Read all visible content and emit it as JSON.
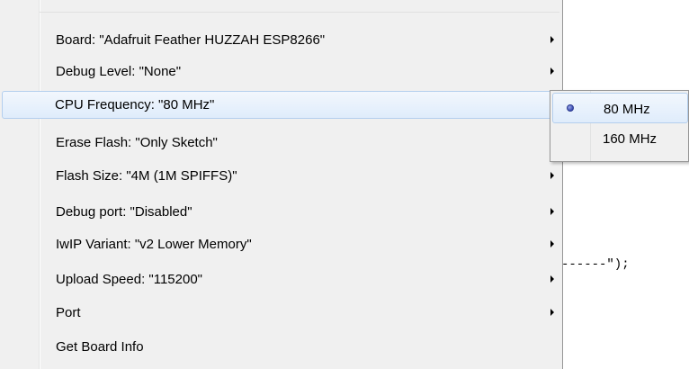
{
  "editor": {
    "code_fragment": "------\");"
  },
  "menu": {
    "items": [
      {
        "label": "Board: \"Adafruit Feather HUZZAH ESP8266\"",
        "has_submenu": true
      },
      {
        "label": "Debug Level: \"None\"",
        "has_submenu": true
      },
      {
        "label": "CPU Frequency: \"80 MHz\"",
        "has_submenu": true,
        "highlighted": true
      },
      {
        "label": "Erase Flash: \"Only Sketch\"",
        "has_submenu": true
      },
      {
        "label": "Flash Size: \"4M (1M SPIFFS)\"",
        "has_submenu": true
      },
      {
        "label": "Debug port: \"Disabled\"",
        "has_submenu": true
      },
      {
        "label": "IwIP Variant: \"v2 Lower Memory\"",
        "has_submenu": true
      },
      {
        "label": "Upload Speed: \"115200\"",
        "has_submenu": true
      },
      {
        "label": "Port",
        "has_submenu": true
      },
      {
        "label": "Get Board Info",
        "has_submenu": false
      }
    ]
  },
  "submenu": {
    "items": [
      {
        "label": "80 MHz",
        "selected": true
      },
      {
        "label": "160 MHz",
        "selected": false
      }
    ]
  },
  "colors": {
    "menu_bg": "#f0f0f0",
    "highlight_border": "#b4cfee",
    "radio_accent": "#3a4bb0"
  }
}
